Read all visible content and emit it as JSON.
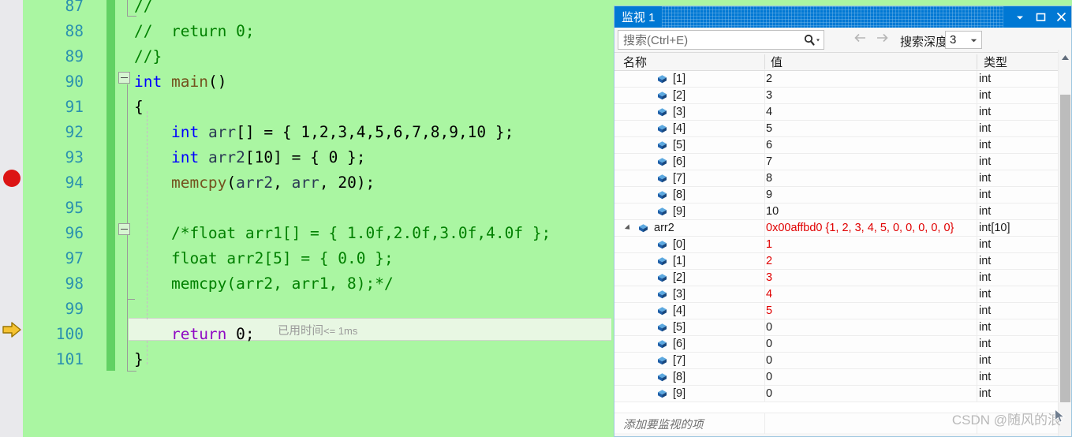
{
  "editor": {
    "first_partial_line": "87",
    "lines": [
      {
        "num": "87",
        "spans": [
          {
            "t": "//",
            "c": "cmt"
          }
        ],
        "indent": 0
      },
      {
        "num": "88",
        "spans": [
          {
            "t": "//  return 0;",
            "c": "cmt"
          }
        ],
        "indent": 0
      },
      {
        "num": "89",
        "spans": [
          {
            "t": "//}",
            "c": "cmt"
          }
        ],
        "indent": 0
      },
      {
        "num": "90",
        "spans": [
          {
            "t": "int",
            "c": "kw"
          },
          {
            "t": " ",
            "c": "num"
          },
          {
            "t": "main",
            "c": "fn"
          },
          {
            "t": "()",
            "c": "num"
          }
        ],
        "indent": 0
      },
      {
        "num": "91",
        "spans": [
          {
            "t": "{",
            "c": "num"
          }
        ],
        "indent": 0
      },
      {
        "num": "92",
        "spans": [
          {
            "t": "    ",
            "c": "num"
          },
          {
            "t": "int",
            "c": "kw"
          },
          {
            "t": " ",
            "c": "num"
          },
          {
            "t": "arr",
            "c": "ident"
          },
          {
            "t": "[] = { 1,2,3,4,5,6,7,8,9,10 };",
            "c": "num"
          }
        ],
        "indent": 1
      },
      {
        "num": "93",
        "spans": [
          {
            "t": "    ",
            "c": "num"
          },
          {
            "t": "int",
            "c": "kw"
          },
          {
            "t": " ",
            "c": "num"
          },
          {
            "t": "arr2",
            "c": "ident"
          },
          {
            "t": "[10] = { 0 };",
            "c": "num"
          }
        ],
        "indent": 1
      },
      {
        "num": "94",
        "spans": [
          {
            "t": "    ",
            "c": "num"
          },
          {
            "t": "memcpy",
            "c": "fn"
          },
          {
            "t": "(",
            "c": "num"
          },
          {
            "t": "arr2",
            "c": "ident"
          },
          {
            "t": ", ",
            "c": "num"
          },
          {
            "t": "arr",
            "c": "ident"
          },
          {
            "t": ", 20);",
            "c": "num"
          }
        ],
        "indent": 1
      },
      {
        "num": "95",
        "spans": [],
        "indent": 1
      },
      {
        "num": "96",
        "spans": [
          {
            "t": "    /*float arr1[] = { 1.0f,2.0f,3.0f,4.0f };",
            "c": "cmt"
          }
        ],
        "indent": 1
      },
      {
        "num": "97",
        "spans": [
          {
            "t": "    float arr2[5] = { 0.0 };",
            "c": "cmt"
          }
        ],
        "indent": 1
      },
      {
        "num": "98",
        "spans": [
          {
            "t": "    memcpy(arr2, arr1, 8);*/",
            "c": "cmt"
          }
        ],
        "indent": 1
      },
      {
        "num": "99",
        "spans": [],
        "indent": 1
      },
      {
        "num": "100",
        "spans": [
          {
            "t": "    ",
            "c": "num"
          },
          {
            "t": "return",
            "c": "ctl"
          },
          {
            "t": " ",
            "c": "num"
          },
          {
            "t": "0",
            "c": "num"
          },
          {
            "t": ";",
            "c": "num"
          }
        ],
        "indent": 1
      },
      {
        "num": "101",
        "spans": [
          {
            "t": "}",
            "c": "num"
          }
        ],
        "indent": 0
      }
    ],
    "elapsed_label": "已用时间",
    "elapsed_value": "<= 1ms",
    "breakpoint_line": "94",
    "current_line": "100"
  },
  "watch": {
    "title": "监视 1",
    "buttons": {
      "dropdown": "chevron-down-icon",
      "maximize": "maximize-icon",
      "close": "close-icon"
    },
    "search": {
      "placeholder": "搜索(Ctrl+E)",
      "value": ""
    },
    "depth": {
      "label": "搜索深度:",
      "value": "3"
    },
    "columns": {
      "name": "名称",
      "value": "值",
      "type": "类型"
    },
    "add_item_text": "添加要监视的项",
    "rows": [
      {
        "name": "[1]",
        "value": "2",
        "type": "int",
        "indent": 2,
        "changed": false,
        "expander": ""
      },
      {
        "name": "[2]",
        "value": "3",
        "type": "int",
        "indent": 2,
        "changed": false,
        "expander": ""
      },
      {
        "name": "[3]",
        "value": "4",
        "type": "int",
        "indent": 2,
        "changed": false,
        "expander": ""
      },
      {
        "name": "[4]",
        "value": "5",
        "type": "int",
        "indent": 2,
        "changed": false,
        "expander": ""
      },
      {
        "name": "[5]",
        "value": "6",
        "type": "int",
        "indent": 2,
        "changed": false,
        "expander": ""
      },
      {
        "name": "[6]",
        "value": "7",
        "type": "int",
        "indent": 2,
        "changed": false,
        "expander": ""
      },
      {
        "name": "[7]",
        "value": "8",
        "type": "int",
        "indent": 2,
        "changed": false,
        "expander": ""
      },
      {
        "name": "[8]",
        "value": "9",
        "type": "int",
        "indent": 2,
        "changed": false,
        "expander": ""
      },
      {
        "name": "[9]",
        "value": "10",
        "type": "int",
        "indent": 2,
        "changed": false,
        "expander": ""
      },
      {
        "name": "arr2",
        "value": "0x00affbd0 {1, 2, 3, 4, 5, 0, 0, 0, 0, 0}",
        "type": "int[10]",
        "indent": 1,
        "changed": true,
        "expander": "expanded"
      },
      {
        "name": "[0]",
        "value": "1",
        "type": "int",
        "indent": 2,
        "changed": true,
        "expander": ""
      },
      {
        "name": "[1]",
        "value": "2",
        "type": "int",
        "indent": 2,
        "changed": true,
        "expander": ""
      },
      {
        "name": "[2]",
        "value": "3",
        "type": "int",
        "indent": 2,
        "changed": true,
        "expander": ""
      },
      {
        "name": "[3]",
        "value": "4",
        "type": "int",
        "indent": 2,
        "changed": true,
        "expander": ""
      },
      {
        "name": "[4]",
        "value": "5",
        "type": "int",
        "indent": 2,
        "changed": true,
        "expander": ""
      },
      {
        "name": "[5]",
        "value": "0",
        "type": "int",
        "indent": 2,
        "changed": false,
        "expander": ""
      },
      {
        "name": "[6]",
        "value": "0",
        "type": "int",
        "indent": 2,
        "changed": false,
        "expander": ""
      },
      {
        "name": "[7]",
        "value": "0",
        "type": "int",
        "indent": 2,
        "changed": false,
        "expander": ""
      },
      {
        "name": "[8]",
        "value": "0",
        "type": "int",
        "indent": 2,
        "changed": false,
        "expander": ""
      },
      {
        "name": "[9]",
        "value": "0",
        "type": "int",
        "indent": 2,
        "changed": false,
        "expander": ""
      }
    ]
  },
  "watermark": "CSDN @随风的浪",
  "colors": {
    "editor_background": "#aaf6a2",
    "accent_title": "#0078d4",
    "changed_value": "#e00000",
    "line_number": "#2b91af",
    "keyword": "#0000ff",
    "comment": "#008000",
    "function": "#74531f",
    "control_keyword": "#8f08c4",
    "breakpoint": "#dc1414",
    "change_bar": "#62d164"
  }
}
